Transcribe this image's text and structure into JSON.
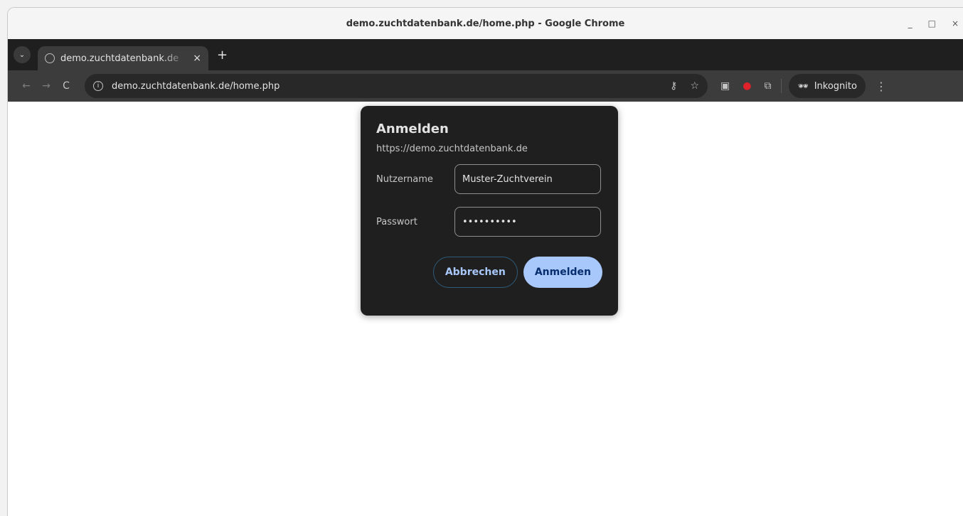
{
  "window": {
    "title": "demo.zuchtdatenbank.de/home.php - Google Chrome",
    "controls": {
      "minimize": "_",
      "maximize": "□",
      "close": "×"
    }
  },
  "tabstrip": {
    "menu_icon": "⌄",
    "tab_title": "demo.zuchtdatenbank.de",
    "tab_close": "×",
    "new_tab": "+"
  },
  "toolbar": {
    "back": "←",
    "forward": "→",
    "reload": "C",
    "info_icon": "i",
    "url": "demo.zuchtdatenbank.de/home.php",
    "key_icon": "⚷",
    "star_icon": "☆",
    "ext1_icon": "▣",
    "ext2_icon": "●",
    "extensions_icon": "⧉",
    "incognito_icon": "🕶",
    "incognito_label": "Inkognito",
    "menu_icon": "⋮"
  },
  "dialog": {
    "title": "Anmelden",
    "origin": "https://demo.zuchtdatenbank.de",
    "username_label": "Nutzername",
    "username_value": "Muster-Zuchtverein",
    "password_label": "Passwort",
    "password_value": "••••••••••",
    "cancel_label": "Abbrechen",
    "submit_label": "Anmelden"
  }
}
